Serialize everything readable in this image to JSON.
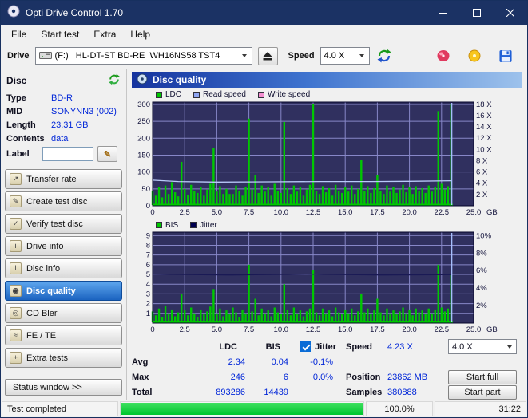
{
  "window": {
    "title": "Opti Drive Control 1.70"
  },
  "menu": [
    "File",
    "Start test",
    "Extra",
    "Help"
  ],
  "toolbar": {
    "drive_label": "Drive",
    "drive_value": "(F:)   HL-DT-ST BD-RE  WH16NS58 TST4",
    "speed_label": "Speed",
    "speed_value": "4.0 X"
  },
  "icons": {
    "transfer_rate": "↗",
    "create_test_disc": "✎",
    "verify_test_disc": "✓",
    "drive_info": "i",
    "disc_info": "i",
    "disc_quality": "◉",
    "cd_bler": "◎",
    "fe_te": "≈",
    "extra_tests": "+",
    "edit_label": "✎"
  },
  "sidebar": {
    "header": "Disc",
    "info": [
      {
        "label": "Type",
        "value": "BD-R"
      },
      {
        "label": "MID",
        "value": "SONYNN3 (002)"
      },
      {
        "label": "Length",
        "value": "23.31 GB"
      },
      {
        "label": "Contents",
        "value": "data"
      }
    ],
    "label_field": {
      "label": "Label",
      "value": ""
    },
    "buttons": [
      {
        "label": "Transfer rate",
        "active": false
      },
      {
        "label": "Create test disc",
        "active": false
      },
      {
        "label": "Verify test disc",
        "active": false
      },
      {
        "label": "Drive info",
        "active": false
      },
      {
        "label": "Disc info",
        "active": false
      },
      {
        "label": "Disc quality",
        "active": true
      },
      {
        "label": "CD Bler",
        "active": false
      },
      {
        "label": "FE / TE",
        "active": false
      },
      {
        "label": "Extra tests",
        "active": false
      }
    ],
    "status_window_label": "Status window >>"
  },
  "panel": {
    "title": "Disc quality",
    "legend_top": [
      {
        "label": "LDC",
        "color": "#00c800"
      },
      {
        "label": "Read speed",
        "color": "#8fa6f2"
      },
      {
        "label": "Write speed",
        "color": "#f48fd0"
      }
    ],
    "legend_bottom": [
      {
        "label": "BIS",
        "color": "#00c800"
      },
      {
        "label": "Jitter",
        "color": "#000050"
      }
    ]
  },
  "stats": {
    "headers": {
      "ldc": "LDC",
      "bis": "BIS",
      "jitter": "Jitter"
    },
    "jitter_checked": true,
    "rows": {
      "avg": {
        "label": "Avg",
        "ldc": "2.34",
        "bis": "0.04",
        "jitter": "-0.1%"
      },
      "max": {
        "label": "Max",
        "ldc": "246",
        "bis": "6",
        "jitter": "0.0%"
      },
      "total": {
        "label": "Total",
        "ldc": "893286",
        "bis": "14439"
      }
    },
    "right": {
      "speed_label": "Speed",
      "speed_value": "4.23 X",
      "position_label": "Position",
      "position_value": "23862 MB",
      "samples_label": "Samples",
      "samples_value": "380888"
    },
    "speed_combo": "4.0 X",
    "start_full_label": "Start full",
    "start_part_label": "Start part"
  },
  "statusbar": {
    "status": "Test completed",
    "progress_percent": 100,
    "percent_label": "100.0%",
    "time": "31:22"
  },
  "colors": {
    "titlebar": "#1b3264",
    "chart_background": "#30305f",
    "chart_grid": "#8787c8",
    "value_text": "#0026d8",
    "progress_green": "#00c62e",
    "active_button": "#1b63c0"
  },
  "chart_data": [
    {
      "type": "bar",
      "title": "LDC / Read speed / Write speed",
      "x_unit": "GB",
      "x_max": 25,
      "x_ticks": [
        0,
        2.5,
        5.0,
        7.5,
        10.0,
        12.5,
        15.0,
        17.5,
        20.0,
        22.5,
        25.0
      ],
      "left_axis": {
        "ticks": [
          0,
          50,
          100,
          150,
          200,
          250,
          300
        ],
        "max": 307
      },
      "right_axis": {
        "ticks": [
          2,
          4,
          6,
          8,
          10,
          12,
          14,
          16,
          18
        ],
        "max": 18.4,
        "unit": " X"
      },
      "bg": "#30305f",
      "grid_color": "#8787c8",
      "border_color": "#05052a",
      "end_line_x": 23.3,
      "end_line_color": "#a9c0ff",
      "series": [
        {
          "name": "LDC",
          "style": "impulse",
          "axis": "left",
          "color": "#00c800",
          "x0": 0,
          "step": 0.25,
          "values": [
            45,
            30,
            55,
            25,
            60,
            35,
            70,
            40,
            28,
            130,
            50,
            33,
            62,
            45,
            38,
            55,
            30,
            48,
            65,
            170,
            42,
            58,
            35,
            50,
            35,
            35,
            60,
            45,
            30,
            55,
            258,
            48,
            92,
            38,
            60,
            42,
            55,
            30,
            65,
            45,
            38,
            248,
            52,
            35,
            60,
            42,
            55,
            30,
            48,
            62,
            300,
            45,
            35,
            58,
            40,
            52,
            30,
            62,
            45,
            38,
            55,
            42,
            60,
            35,
            50,
            135,
            45,
            58,
            38,
            52,
            90,
            45,
            35,
            60,
            42,
            55,
            38,
            48,
            62,
            40,
            55,
            35,
            58,
            45,
            52,
            38,
            60,
            42,
            55,
            280,
            65,
            48,
            58,
            300,
            0,
            0,
            0,
            0,
            0,
            0
          ]
        },
        {
          "name": "Read speed",
          "style": "line",
          "axis": "right",
          "color": "#b9c9f8",
          "points": [
            [
              0,
              4.55
            ],
            [
              2,
              4.3
            ],
            [
              5,
              4.2
            ],
            [
              9,
              4.25
            ],
            [
              13,
              4.3
            ],
            [
              17,
              4.3
            ],
            [
              20,
              4.35
            ],
            [
              23.3,
              4.45
            ]
          ]
        }
      ]
    },
    {
      "type": "bar",
      "title": "BIS / Jitter",
      "x_unit": "GB",
      "x_max": 25,
      "x_ticks": [
        0,
        2.5,
        5.0,
        7.5,
        10.0,
        12.5,
        15.0,
        17.5,
        20.0,
        22.5,
        25.0
      ],
      "left_axis": {
        "ticks": [
          1,
          2,
          3,
          4,
          5,
          6,
          7,
          8,
          9
        ],
        "max": 9.35
      },
      "right_axis": {
        "ticks": [
          2,
          4,
          6,
          8,
          10
        ],
        "max": 10.4,
        "unit": "%"
      },
      "bg": "#30305f",
      "grid_color": "#8787c8",
      "border_color": "#05052a",
      "end_line_x": 23.3,
      "end_line_color": "#a9c0ff",
      "series": [
        {
          "name": "BIS",
          "style": "impulse",
          "axis": "left",
          "color": "#00c800",
          "x0": 0,
          "step": 0.25,
          "values": [
            1.2,
            0.8,
            1.5,
            0.6,
            1.8,
            1.0,
            1.4,
            0.7,
            1.1,
            3.0,
            1.3,
            0.8,
            1.6,
            1.0,
            0.6,
            1.4,
            0.9,
            1.2,
            1.7,
            3.5,
            1.0,
            1.5,
            0.7,
            1.3,
            0.9,
            1.6,
            1.1,
            0.6,
            1.4,
            1.0,
            6.0,
            1.2,
            2.5,
            0.8,
            1.5,
            1.0,
            1.3,
            0.7,
            1.6,
            1.1,
            0.9,
            4.0,
            1.4,
            0.8,
            1.6,
            1.0,
            1.3,
            0.7,
            1.2,
            1.5,
            5.5,
            1.1,
            0.8,
            1.5,
            1.0,
            1.3,
            0.7,
            1.6,
            1.1,
            0.9,
            1.4,
            1.0,
            1.5,
            0.8,
            1.2,
            3.0,
            1.1,
            1.5,
            0.9,
            1.3,
            2.5,
            1.1,
            0.8,
            1.5,
            1.0,
            1.3,
            0.9,
            1.2,
            1.6,
            1.0,
            1.4,
            0.8,
            1.5,
            1.1,
            1.3,
            0.9,
            1.5,
            1.0,
            1.4,
            6.0,
            1.6,
            1.2,
            1.5,
            5.0,
            0,
            0,
            0,
            0,
            0,
            0
          ]
        },
        {
          "name": "Jitter",
          "style": "line",
          "axis": "right",
          "color": "#1a1a55",
          "points": [
            [
              0,
              5.6
            ],
            [
              6,
              5.5
            ],
            [
              12,
              5.6
            ],
            [
              18,
              5.5
            ],
            [
              23.3,
              5.55
            ]
          ]
        }
      ]
    }
  ]
}
